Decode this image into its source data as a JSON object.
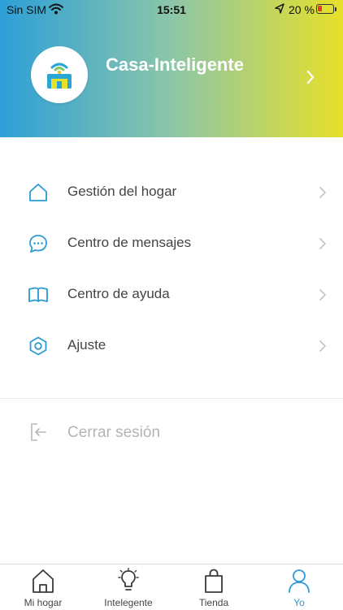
{
  "status_bar": {
    "carrier": "Sin SIM",
    "time": "15:51",
    "battery": "20 %"
  },
  "profile": {
    "home_name": "Casa-Inteligente",
    "avatar_icon": "smart-home-logo-icon"
  },
  "menu": [
    {
      "label": "Gestión del hogar",
      "icon": "house-icon"
    },
    {
      "label": "Centro de mensajes",
      "icon": "message-bubble-icon"
    },
    {
      "label": "Centro de ayuda",
      "icon": "book-icon"
    },
    {
      "label": "Ajuste",
      "icon": "settings-hexagon-icon"
    }
  ],
  "logout": {
    "label": "Cerrar sesión",
    "icon": "logout-icon"
  },
  "tabbar": {
    "tabs": [
      {
        "label": "Mi hogar",
        "icon": "home-icon"
      },
      {
        "label": "Intelegente",
        "icon": "bulb-icon"
      },
      {
        "label": "Tienda",
        "icon": "shopping-bag-icon"
      },
      {
        "label": "Yo",
        "icon": "person-icon"
      }
    ],
    "active_index": 3
  },
  "colors": {
    "accent": "#2a9bd4",
    "gradient_start": "#2c9fd8",
    "gradient_end": "#e7e02a",
    "battery_low": "#e23b2e",
    "disabled_text": "#b4b4b4"
  }
}
